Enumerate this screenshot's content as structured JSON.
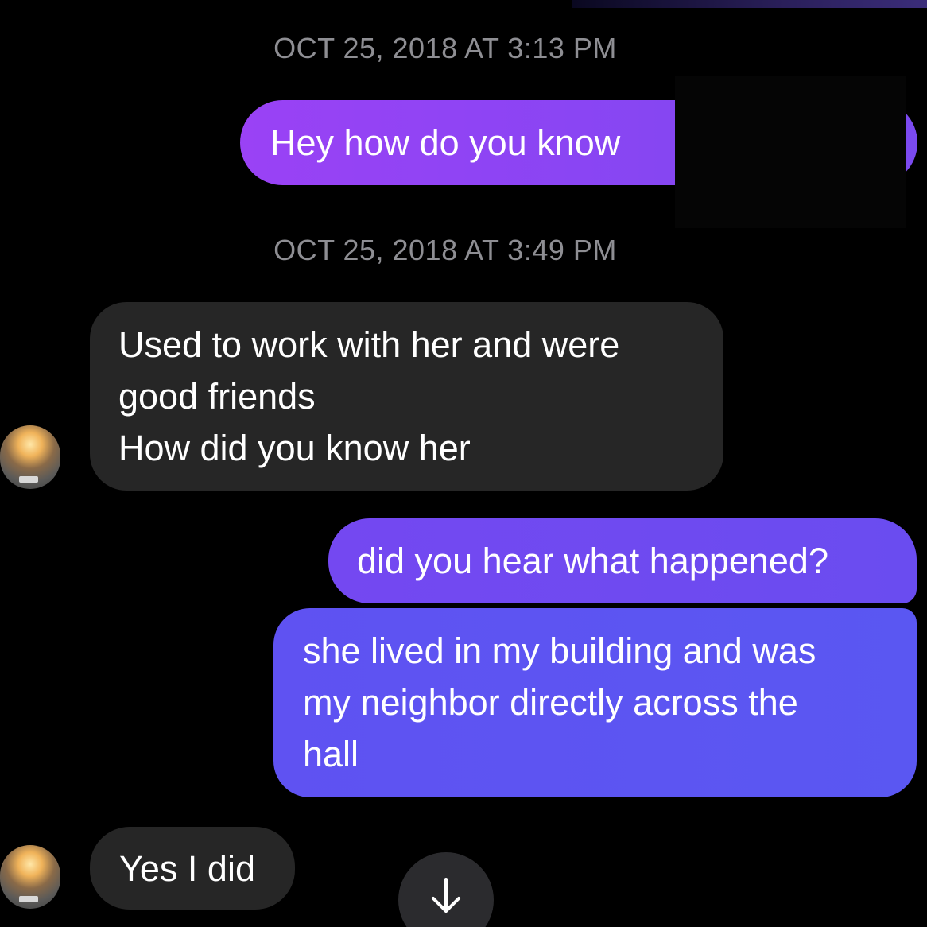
{
  "thread": {
    "messages": [
      {
        "type": "timestamp",
        "text": "OCT 25, 2018 AT 3:13 PM"
      },
      {
        "type": "sent",
        "text": "Hey how do you know "
      },
      {
        "type": "timestamp",
        "text": "OCT 25, 2018 AT 3:49 PM"
      },
      {
        "type": "received",
        "lines": [
          "Used to work with her and were",
          "good friends",
          "How did you know her"
        ]
      },
      {
        "type": "sent",
        "text": "did you hear what happened?"
      },
      {
        "type": "sent",
        "lines": [
          "she lived in my building and was",
          "my neighbor directly across the",
          "hall"
        ]
      },
      {
        "type": "received",
        "text": "Yes I did"
      }
    ]
  },
  "icons": {
    "scroll_down": "arrow-down-icon",
    "avatar": "contact-avatar"
  },
  "colors": {
    "background": "#000000",
    "sent_bubble_start": "#9a42f5",
    "sent_bubble_end": "#5a57f2",
    "received_bubble": "#262626",
    "timestamp_text": "#8e8e93"
  }
}
